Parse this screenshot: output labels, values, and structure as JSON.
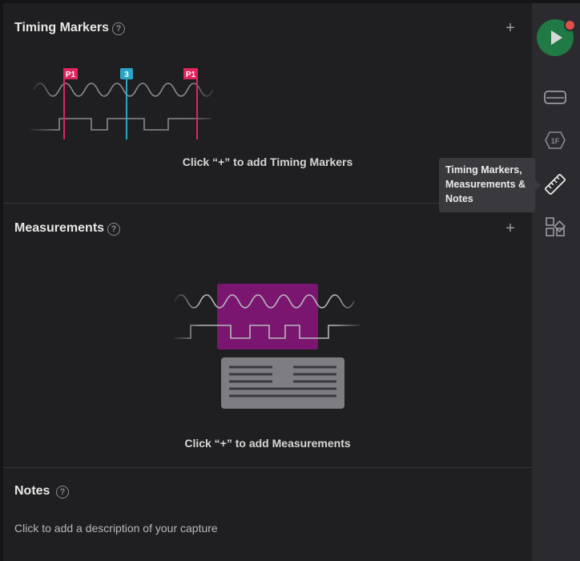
{
  "timing_markers": {
    "title": "Timing Markers",
    "help": "?",
    "add": "+",
    "hint": "Click “+” to add Timing Markers",
    "marker_labels": [
      "P1",
      "3",
      "P1"
    ]
  },
  "measurements": {
    "title": "Measurements",
    "help": "?",
    "add": "+",
    "hint": "Click “+” to add Measurements"
  },
  "notes": {
    "title": "Notes",
    "help": "?",
    "placeholder": "Click to add a description of your capture"
  },
  "sidebar": {
    "tooltip": "Timing Markers, Measurements & Notes",
    "icons": [
      "play-icon",
      "device-icon",
      "analyzer-1f-icon",
      "ruler-icon",
      "extensions-icon"
    ]
  },
  "colors": {
    "marker_pink": "#e0245e",
    "marker_cyan": "#2aa6c4",
    "measure_purple": "#7a1670",
    "run_green": "#1f7a45",
    "status_red": "#e0504a"
  }
}
